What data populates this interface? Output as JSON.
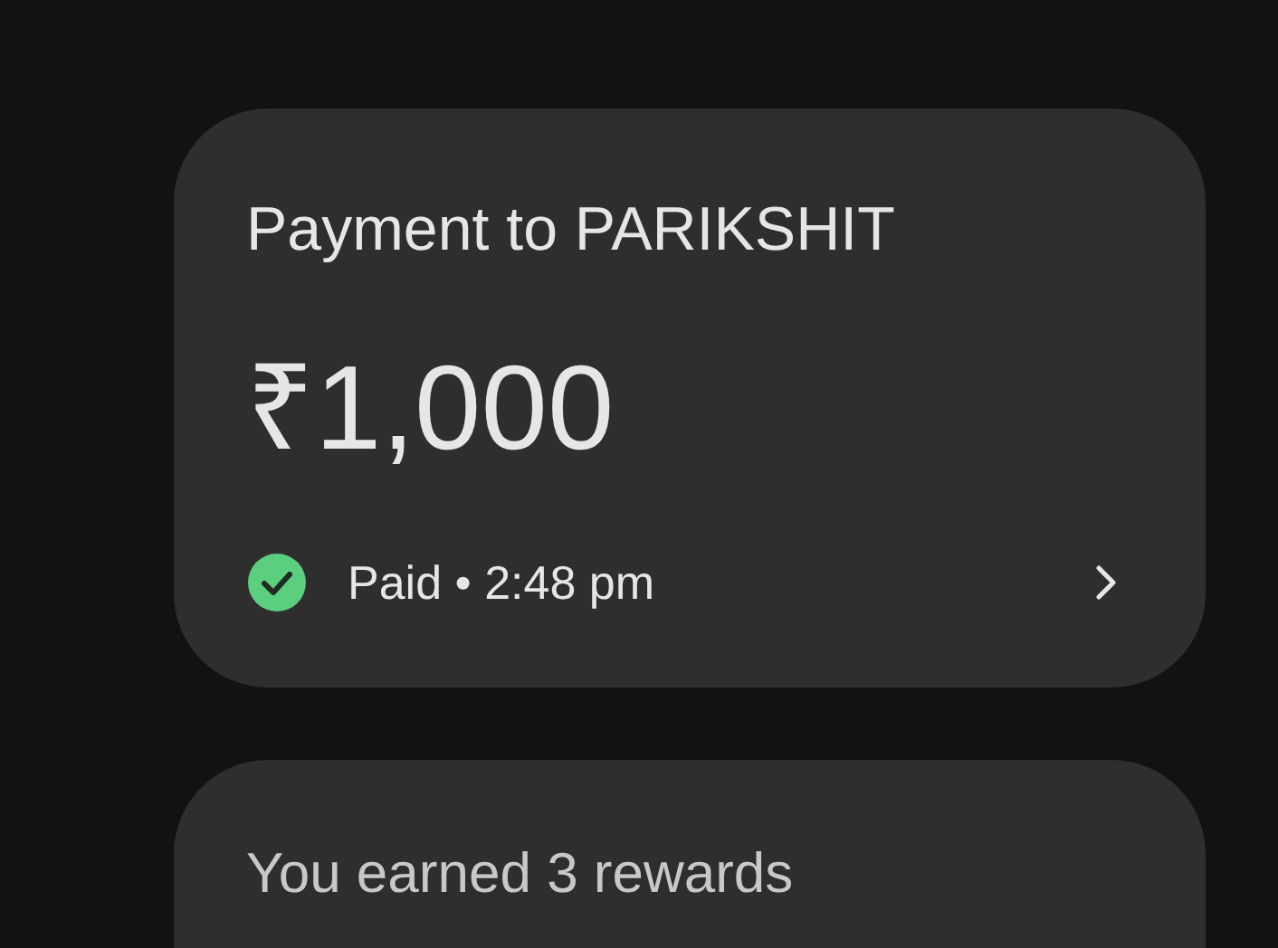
{
  "payment_card": {
    "title": "Payment to PARIKSHIT",
    "amount": "₹1,000",
    "status": {
      "paid": true,
      "text": "Paid • 2:48 pm"
    }
  },
  "rewards_card": {
    "text": "You earned 3 rewards"
  }
}
